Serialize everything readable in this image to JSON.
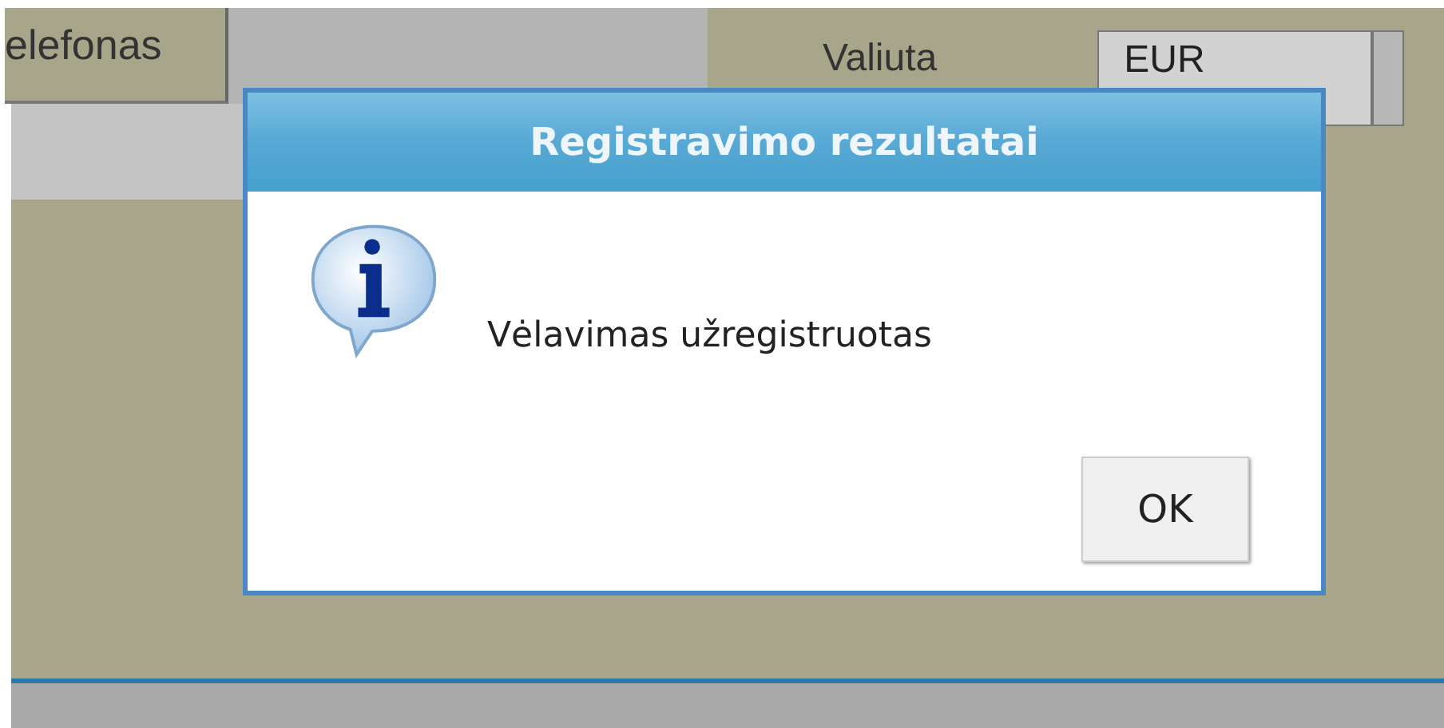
{
  "form": {
    "phone_label": "elefonas",
    "currency_label": "Valiuta",
    "currency_value": "EUR"
  },
  "dialog": {
    "title": "Registravimo rezultatai",
    "message": "Vėlavimas užregistruotas",
    "buttons": [
      "OK"
    ]
  }
}
